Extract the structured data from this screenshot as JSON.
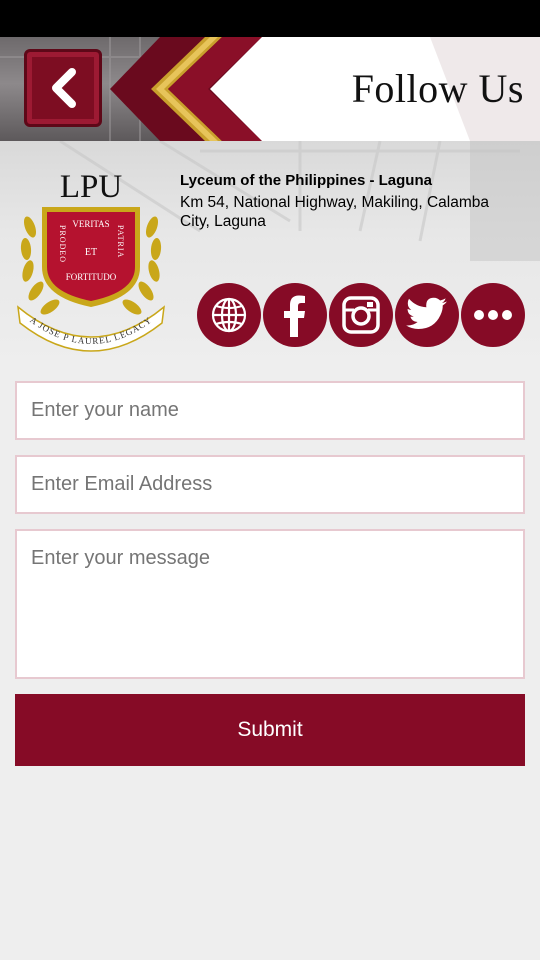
{
  "header": {
    "title": "Follow Us",
    "back_icon": "chevron-left-icon"
  },
  "organization": {
    "logo_text": "LPU",
    "logo_motto_top": "VERITAS",
    "logo_motto_left": "PRODEO",
    "logo_motto_center": "ET",
    "logo_motto_right": "PATRIA",
    "logo_motto_bottom": "FORTITUDO",
    "logo_ribbon": "A JOSE P LAUREL LEGACY",
    "name": "Lyceum of the Philippines - Laguna",
    "address": "Km 54, National Highway, Makiling, Calamba City, Laguna"
  },
  "social": [
    {
      "icon": "globe-icon"
    },
    {
      "icon": "facebook-icon"
    },
    {
      "icon": "instagram-icon"
    },
    {
      "icon": "twitter-icon"
    },
    {
      "icon": "more-icon"
    }
  ],
  "form": {
    "name_placeholder": "Enter your name",
    "email_placeholder": "Enter Email Address",
    "message_placeholder": "Enter your message",
    "submit_label": "Submit"
  },
  "colors": {
    "brand": "#860b26",
    "field_border": "#e7c9d0",
    "background": "#eeeeee"
  }
}
